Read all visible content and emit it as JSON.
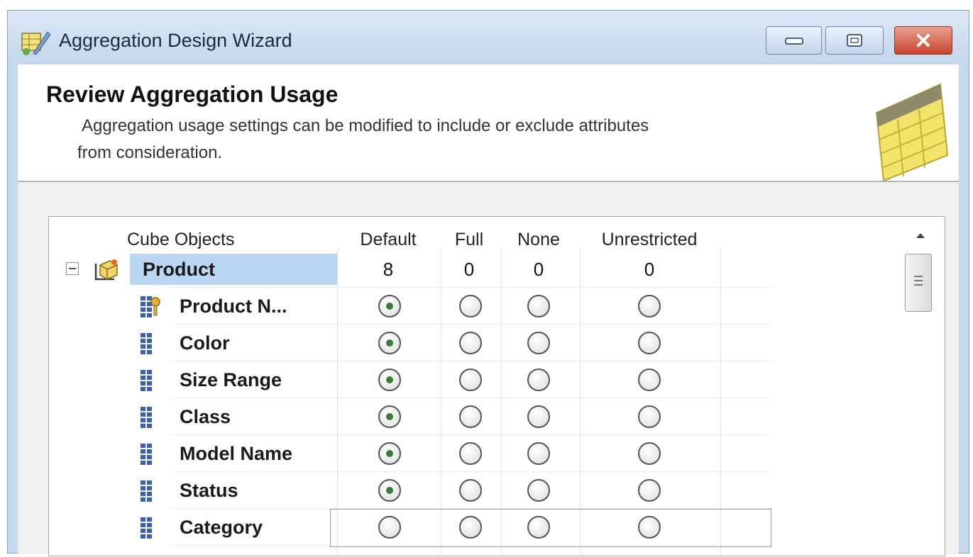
{
  "window": {
    "title": "Aggregation Design Wizard"
  },
  "header": {
    "heading": "Review Aggregation Usage",
    "description_line1": "Aggregation usage settings can be modified to include or exclude attributes",
    "description_line2": "from consideration."
  },
  "grid": {
    "columns": [
      "Cube Objects",
      "Default",
      "Full",
      "None",
      "Unrestricted"
    ],
    "dimension": {
      "name": "Product",
      "counts": {
        "default": "8",
        "full": "0",
        "none": "0",
        "unrestricted": "0"
      },
      "expanded": true,
      "selected": true
    },
    "attributes": [
      {
        "name": "Product N...",
        "usage": "Default",
        "icon": "key-attribute-icon"
      },
      {
        "name": "Color",
        "usage": "Default",
        "icon": "attribute-icon"
      },
      {
        "name": "Size Range",
        "usage": "Default",
        "icon": "attribute-icon"
      },
      {
        "name": "Class",
        "usage": "Default",
        "icon": "attribute-icon"
      },
      {
        "name": "Model Name",
        "usage": "Default",
        "icon": "attribute-icon"
      },
      {
        "name": "Status",
        "usage": "Default",
        "icon": "attribute-icon"
      },
      {
        "name": "Category",
        "usage": "",
        "icon": "attribute-icon"
      }
    ]
  },
  "colors": {
    "selection": "#b9d7f3",
    "radio_dot": "#3b7a3b",
    "title_bar": "#c3d6ec",
    "close_button": "#c9452f"
  }
}
